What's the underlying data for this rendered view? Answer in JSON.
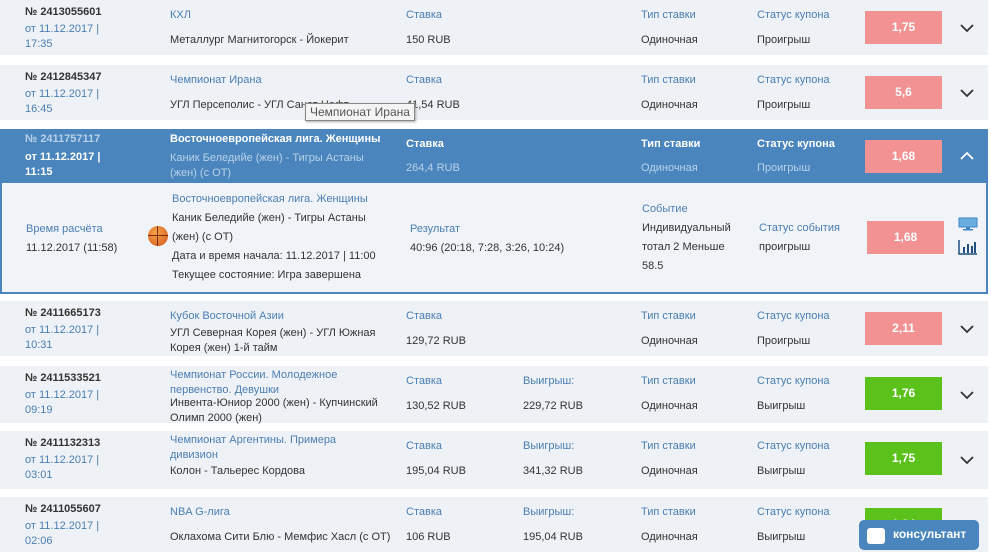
{
  "labels": {
    "stake": "Ставка",
    "win": "Выигрыш:",
    "bet_type": "Тип ставки",
    "coupon_status": "Статус купона"
  },
  "colors": {
    "loss": "#f29293",
    "win": "#5bc21c",
    "accent": "#4a86bd"
  },
  "coupons": [
    {
      "number": "№ 2413055601",
      "date": "от 11.12.2017 | 17:35",
      "league": "КХЛ",
      "match": "Металлург Магнитогорск - Йокерит",
      "stake": "150 RUB",
      "win": "",
      "bet_type": "Одиночная",
      "status": "Проигрыш",
      "odds": "1,75",
      "result": "loss"
    },
    {
      "number": "№ 2412845347",
      "date": "от 11.12.2017 | 16:45",
      "league": "Чемпионат Ирана",
      "match": "УГЛ Персеполис - УГЛ Санат Нафт",
      "stake": "41,54 RUB",
      "win": "",
      "bet_type": "Одиночная",
      "status": "Проигрыш",
      "odds": "5,6",
      "result": "loss"
    },
    {
      "number": "№ 2411757117",
      "date": "от 11.12.2017 | 11:15",
      "league": "Восточноевропейская лига. Женщины",
      "match": "Каник Беледийе (жен) - Тигры Астаны (жен) (с ОТ)",
      "stake": "264,4 RUB",
      "win": "",
      "bet_type": "Одиночная",
      "status": "Проигрыш",
      "odds": "1,68",
      "result": "loss",
      "selected": true
    },
    {
      "number": "№ 2411665173",
      "date": "от 11.12.2017 | 10:31",
      "league": "Кубок Восточной Азии",
      "match": "УГЛ Северная Корея (жен) - УГЛ Южная Корея (жен) 1-й тайм",
      "stake": "129,72 RUB",
      "win": "",
      "bet_type": "Одиночная",
      "status": "Проигрыш",
      "odds": "2,11",
      "result": "loss"
    },
    {
      "number": "№ 2411533521",
      "date": "от 11.12.2017 | 09:19",
      "league": "Чемпионат России. Молодежное первенство. Девушки",
      "match": "Инвента-Юниор 2000 (жен) - Купчинский Олимп 2000 (жен)",
      "stake": "130,52 RUB",
      "win": "229,72 RUB",
      "bet_type": "Одиночная",
      "status": "Выигрыш",
      "odds": "1,76",
      "result": "win"
    },
    {
      "number": "№ 2411132313",
      "date": "от 11.12.2017 | 03:01",
      "league": "Чемпионат Аргентины. Примера дивизион",
      "match": "Колон - Тальерес Кордова",
      "stake": "195,04 RUB",
      "win": "341,32 RUB",
      "bet_type": "Одиночная",
      "status": "Выигрыш",
      "odds": "1,75",
      "result": "win"
    },
    {
      "number": "№ 2411055607",
      "date": "от 11.12.2017 | 02:06",
      "league": "NBA G-лига",
      "match": "Оклахома Сити Блю - Мемфис Хасл (с ОТ)",
      "stake": "106 RUB",
      "win": "195,04 RUB",
      "bet_type": "Одиночная",
      "status": "Выигрыш",
      "odds": "1,84",
      "result": "win"
    }
  ],
  "detail": {
    "calc_label": "Время расчёта",
    "calc_time": "11.12.2017 (11:58)",
    "league": "Восточноевропейская лига. Женщины",
    "match_line1": "Каник Беледийе (жен) - Тигры Астаны",
    "match_line2": "(жен) (с ОТ)",
    "start": "Дата и время начала: 11.12.2017 | 11:00",
    "state": "Текущее состояние: Игра завершена",
    "result_label": "Результат",
    "result": "40:96 (20:18, 7:28, 3:26, 10:24)",
    "event_label": "Событие",
    "event_line1": "Индивидуальный",
    "event_line2": "тотал 2 Меньше",
    "event_line3": "58.5",
    "event_status_label": "Статус события",
    "event_status": "проигрыш",
    "odds": "1,68",
    "sport_icon": "basketball-icon"
  },
  "tooltip": "Чемпионат Ирана",
  "consultant": "консультант"
}
